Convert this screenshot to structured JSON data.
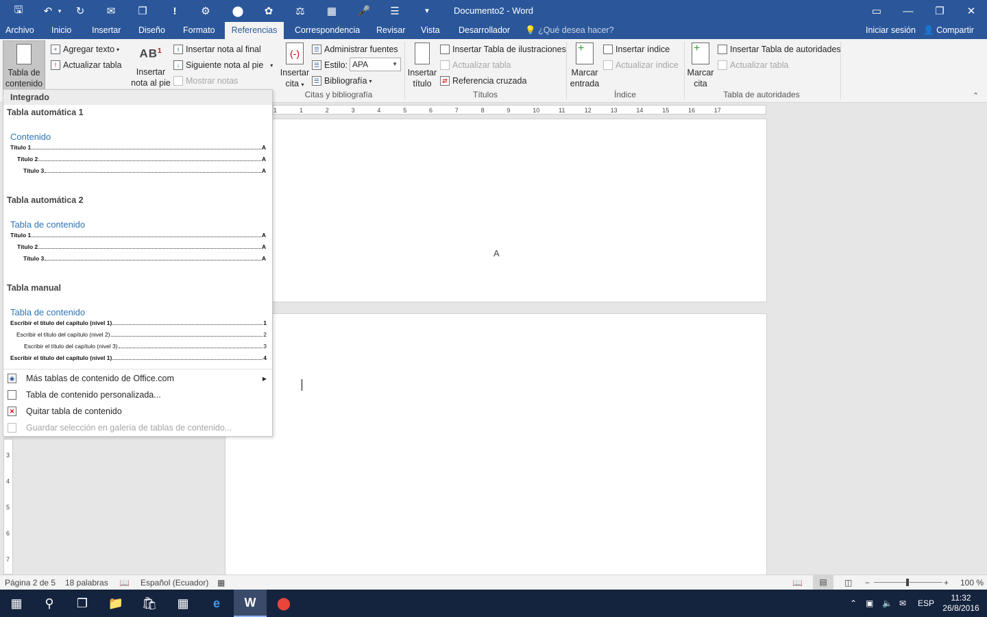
{
  "window": {
    "title": "Documento2 - Word",
    "accent": "#2b579a"
  },
  "qat": {
    "icons": [
      "save-icon",
      "undo-icon",
      "redo-icon",
      "envelope-icon",
      "copy-icon",
      "exclamation-icon",
      "network-icon",
      "circle-icon",
      "ribbon-icon",
      "scales-icon",
      "table-icon",
      "microphone-icon",
      "org-chart-icon",
      "customize-icon"
    ]
  },
  "tabs": [
    "Archivo",
    "Inicio",
    "Insertar",
    "Diseño",
    "Formato",
    "Referencias",
    "Correspondencia",
    "Revisar",
    "Vista",
    "Desarrollador"
  ],
  "active_tab": "Referencias",
  "tellme": "¿Qué desea hacer?",
  "account": {
    "signin": "Iniciar sesión",
    "share": "Compartir"
  },
  "ribbon": {
    "toc": {
      "label_line1": "Tabla de",
      "label_line2": "contenido",
      "add_text": "Agregar texto",
      "update_table": "Actualizar tabla"
    },
    "footnotes": {
      "insert_line1": "Insertar",
      "insert_line2": "nota al pie",
      "insert_endnote": "Insertar nota al final",
      "next_footnote": "Siguiente nota al pie",
      "show_notes": "Mostrar notas",
      "ab_label": "AB",
      "ab_sup": "1"
    },
    "citations": {
      "insert_line1": "Insertar",
      "insert_line2": "cita",
      "manage_sources": "Administrar fuentes",
      "style_label": "Estilo:",
      "style_value": "APA",
      "bibliography": "Bibliografía",
      "group": "Citas y bibliografía"
    },
    "captions": {
      "insert_line1": "Insertar",
      "insert_line2": "título",
      "insert_table_figures": "Insertar Tabla de ilustraciones",
      "update_table": "Actualizar tabla",
      "cross_reference": "Referencia cruzada",
      "group": "Títulos"
    },
    "index": {
      "mark_line1": "Marcar",
      "mark_line2": "entrada",
      "insert_index": "Insertar índice",
      "update_index": "Actualizar índice",
      "group": "Índice"
    },
    "authorities": {
      "mark_line1": "Marcar",
      "mark_line2": "cita",
      "insert_table": "Insertar Tabla de autoridades",
      "update_table": "Actualizar tabla",
      "group": "Tabla de autoridades"
    }
  },
  "toc_menu": {
    "header": "Integrado",
    "galleries": [
      {
        "title": "Tabla automática 1",
        "heading": "Contenido",
        "lines": [
          {
            "text": "Título 1",
            "page": "A"
          },
          {
            "text": "Título 2",
            "page": "A"
          },
          {
            "text": "Título 3",
            "page": "A"
          }
        ]
      },
      {
        "title": "Tabla automática 2",
        "heading": "Tabla de contenido",
        "lines": [
          {
            "text": "Título 1",
            "page": "A"
          },
          {
            "text": "Título 2",
            "page": "A"
          },
          {
            "text": "Título 3",
            "page": "A"
          }
        ]
      },
      {
        "title": "Tabla manual",
        "heading": "Tabla de contenido",
        "lines": [
          {
            "text": "Escribir el título del capítulo (nivel 1)",
            "page": "1"
          },
          {
            "text": "Escribir el título del capítulo (nivel 2)",
            "page": "2"
          },
          {
            "text": "Escribir el título del capítulo (nivel 3)",
            "page": "3"
          },
          {
            "text": "Escribir el título del capítulo (nivel 1)",
            "page": "4"
          }
        ]
      }
    ],
    "items": [
      {
        "label": "Más tablas de contenido de Office.com",
        "submenu": true,
        "enabled": true
      },
      {
        "label": "Tabla de contenido personalizada...",
        "enabled": true
      },
      {
        "label": "Quitar tabla de contenido",
        "enabled": true
      },
      {
        "label": "Guardar selección en galería de tablas de contenido...",
        "enabled": false
      }
    ]
  },
  "document": {
    "page1_char": "A"
  },
  "ruler_ticks": [
    "1",
    "1",
    "2",
    "3",
    "4",
    "5",
    "6",
    "7",
    "8",
    "9",
    "10",
    "11",
    "12",
    "13",
    "14",
    "15",
    "16",
    "17"
  ],
  "vruler_ticks": [
    "3",
    "4",
    "5",
    "6",
    "7"
  ],
  "status": {
    "page": "Página 2 de 5",
    "words": "18 palabras",
    "language": "Español (Ecuador)",
    "zoom": "100 %"
  },
  "taskbar": {
    "time": "11:32",
    "date": "26/8/2016",
    "lang": "ESP"
  }
}
